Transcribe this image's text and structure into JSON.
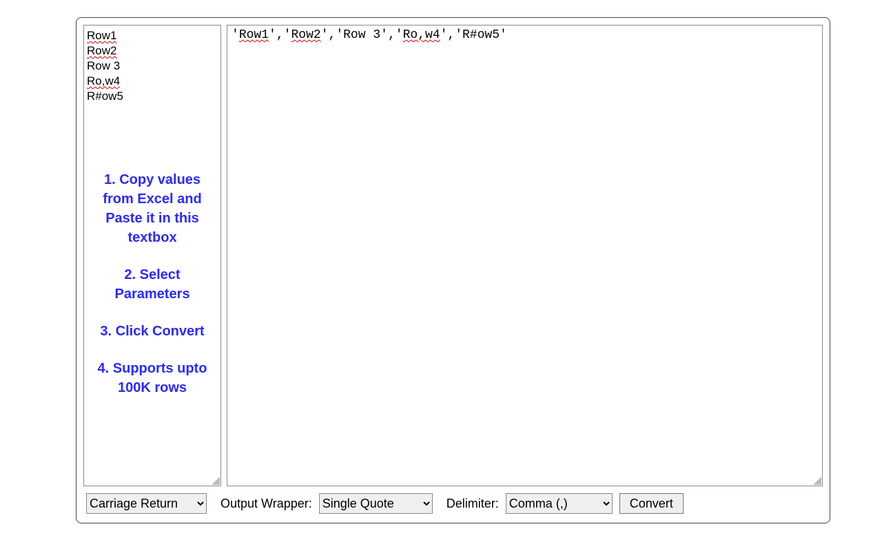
{
  "input": {
    "rows": [
      {
        "pre": "",
        "underlined": "Row1",
        "post": ""
      },
      {
        "pre": "",
        "underlined": "Row2",
        "post": ""
      },
      {
        "pre": "Row  3",
        "underlined": "",
        "post": ""
      },
      {
        "pre": "",
        "underlined": "Ro,w4",
        "post": ""
      },
      {
        "pre": "R#ow5",
        "underlined": "",
        "post": ""
      }
    ]
  },
  "instructions": {
    "step1": "1. Copy values from Excel and Paste it in this textbox",
    "step2": "2. Select Parameters",
    "step3": "3. Click Convert",
    "step4": "4. Supports upto 100K rows"
  },
  "output": {
    "tokens": [
      {
        "q1": "'",
        "u": "Row1",
        "q2": "'",
        "sep": ","
      },
      {
        "q1": "'",
        "u": "Row2",
        "q2": "'",
        "sep": ","
      },
      {
        "q1": "'Row 3'",
        "u": "",
        "q2": "",
        "sep": ","
      },
      {
        "q1": "'",
        "u": "Ro,w4",
        "q2": "'",
        "sep": ","
      },
      {
        "q1": "'R#ow5'",
        "u": "",
        "q2": "",
        "sep": ""
      }
    ]
  },
  "controls": {
    "row_separator": {
      "selected": "Carriage Return",
      "options": [
        "Carriage Return"
      ]
    },
    "output_wrapper_label": "Output Wrapper:",
    "output_wrapper": {
      "selected": "Single Quote",
      "options": [
        "Single Quote"
      ]
    },
    "delimiter_label": "Delimiter:",
    "delimiter": {
      "selected": "Comma (,)",
      "options": [
        "Comma (,)"
      ]
    },
    "convert_label": "Convert"
  }
}
